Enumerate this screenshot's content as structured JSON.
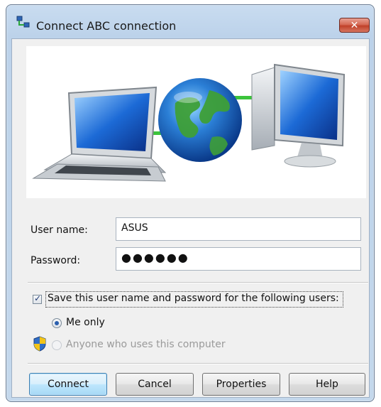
{
  "window": {
    "title": "Connect ABC connection",
    "close_label": "✕"
  },
  "form": {
    "username_label": "User name:",
    "username_value": "ASUS",
    "password_label": "Password:",
    "password_value": "●●●●●●",
    "save_label": "Save this user name and password for the following users:",
    "save_checked": true,
    "radio_me_label": "Me only",
    "radio_anyone_label": "Anyone who uses this computer",
    "selected_option": "Me only"
  },
  "buttons": {
    "connect": "Connect",
    "cancel": "Cancel",
    "properties": "Properties",
    "help": "Help"
  },
  "icons": {
    "title": "network-connection-icon",
    "banner": "laptop-globe-desktop-illustration",
    "shield": "uac-shield-icon"
  },
  "colors": {
    "window_frame": "#c4d8ec",
    "close_button": "#c0412a",
    "default_button": "#3c7fb1",
    "link_green": "#3cc43c"
  }
}
